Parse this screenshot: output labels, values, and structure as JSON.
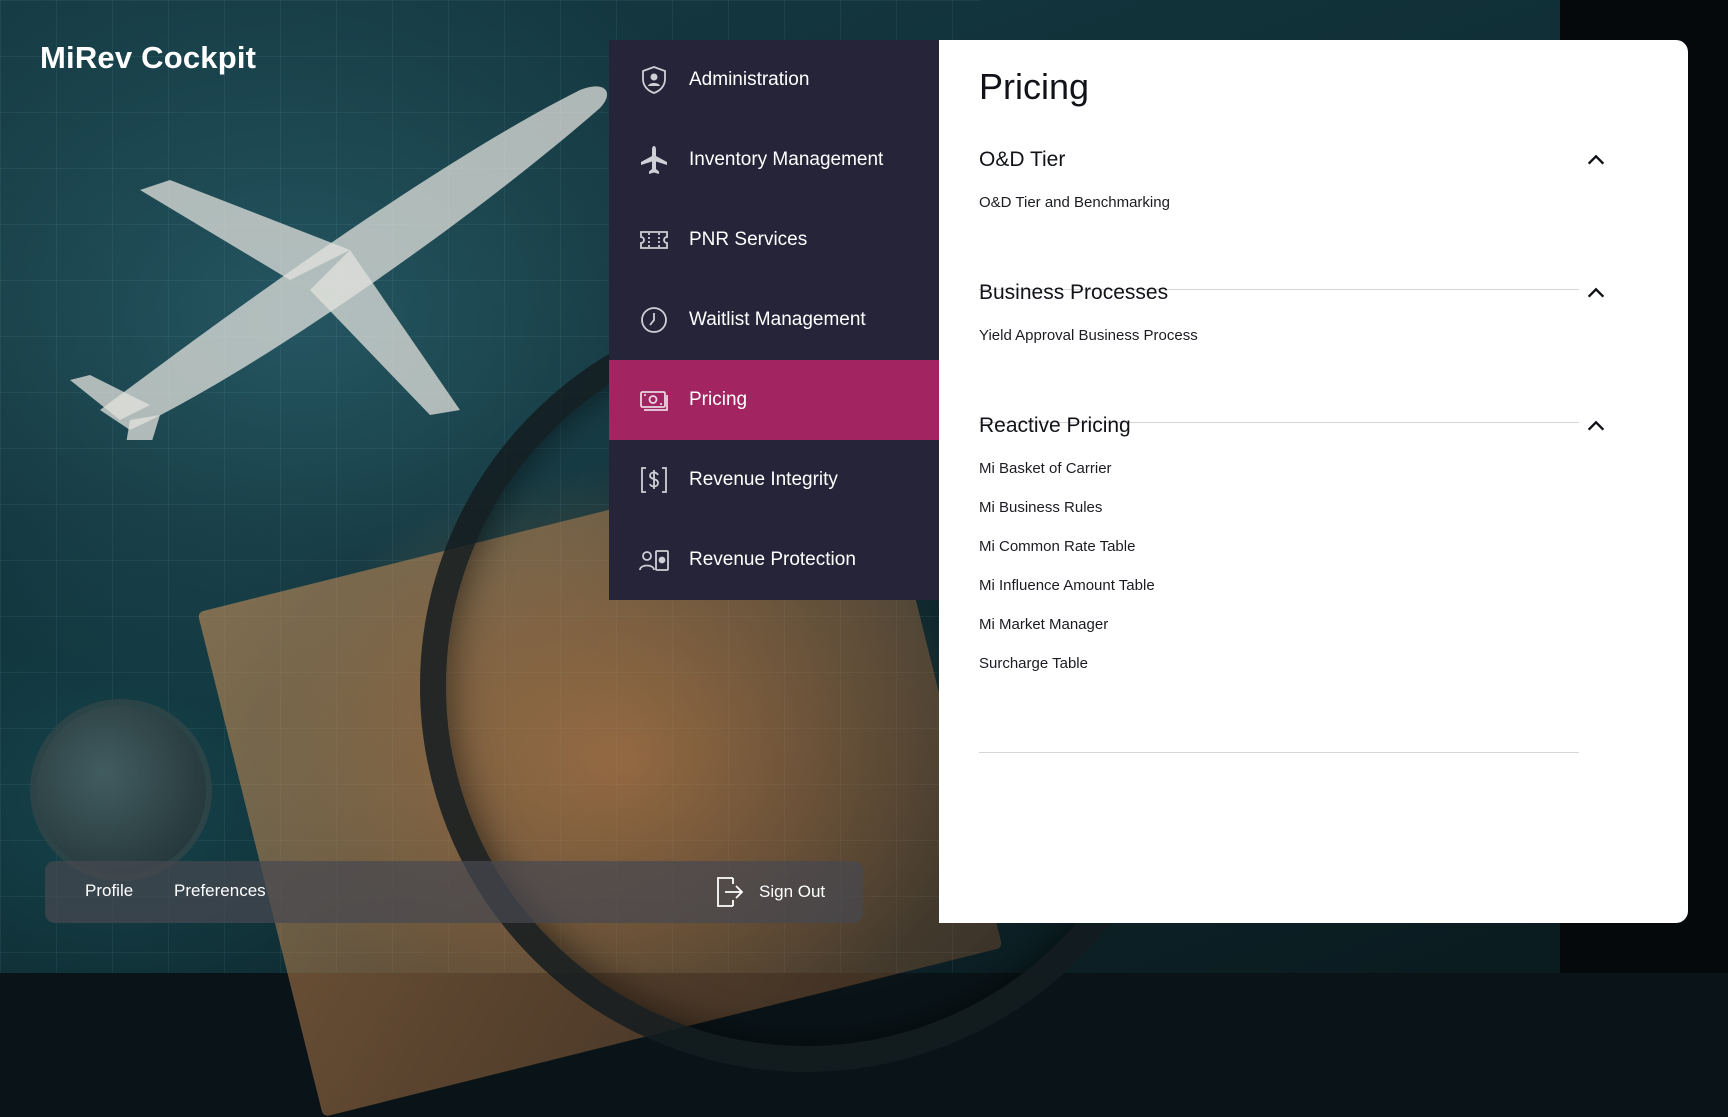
{
  "app": {
    "title": "MiRev Cockpit"
  },
  "colors": {
    "active_menu": "#a22562",
    "menu_bg": "#252439",
    "panel_bg": "#ffffff"
  },
  "sidebar": {
    "items": [
      {
        "label": "Administration",
        "icon": "shield-user-icon",
        "active": false
      },
      {
        "label": "Inventory Management",
        "icon": "airplane-icon",
        "active": false
      },
      {
        "label": "PNR Services",
        "icon": "ticket-icon",
        "active": false
      },
      {
        "label": "Waitlist Management",
        "icon": "clock-icon",
        "active": false
      },
      {
        "label": "Pricing",
        "icon": "money-icon",
        "active": true
      },
      {
        "label": "Revenue Integrity",
        "icon": "dollar-bracket-icon",
        "active": false
      },
      {
        "label": "Revenue Protection",
        "icon": "user-badge-icon",
        "active": false
      }
    ]
  },
  "panel": {
    "title": "Pricing",
    "sections": [
      {
        "title": "O&D Tier",
        "expanded": true,
        "icon": "chevron-up-icon",
        "links": [
          "O&D Tier and Benchmarking"
        ]
      },
      {
        "title": "Business Processes",
        "expanded": true,
        "icon": "chevron-up-icon",
        "links": [
          "Yield Approval Business Process"
        ]
      },
      {
        "title": "Reactive Pricing",
        "expanded": true,
        "icon": "chevron-up-icon",
        "links": [
          "Mi Basket of Carrier",
          "Mi Business Rules",
          "Mi Common Rate Table",
          "Mi Influence Amount Table",
          "Mi Market Manager",
          "Surcharge Table"
        ]
      }
    ]
  },
  "footer": {
    "profile": "Profile",
    "preferences": "Preferences",
    "signout": "Sign Out",
    "signout_icon": "sign-out-icon"
  }
}
